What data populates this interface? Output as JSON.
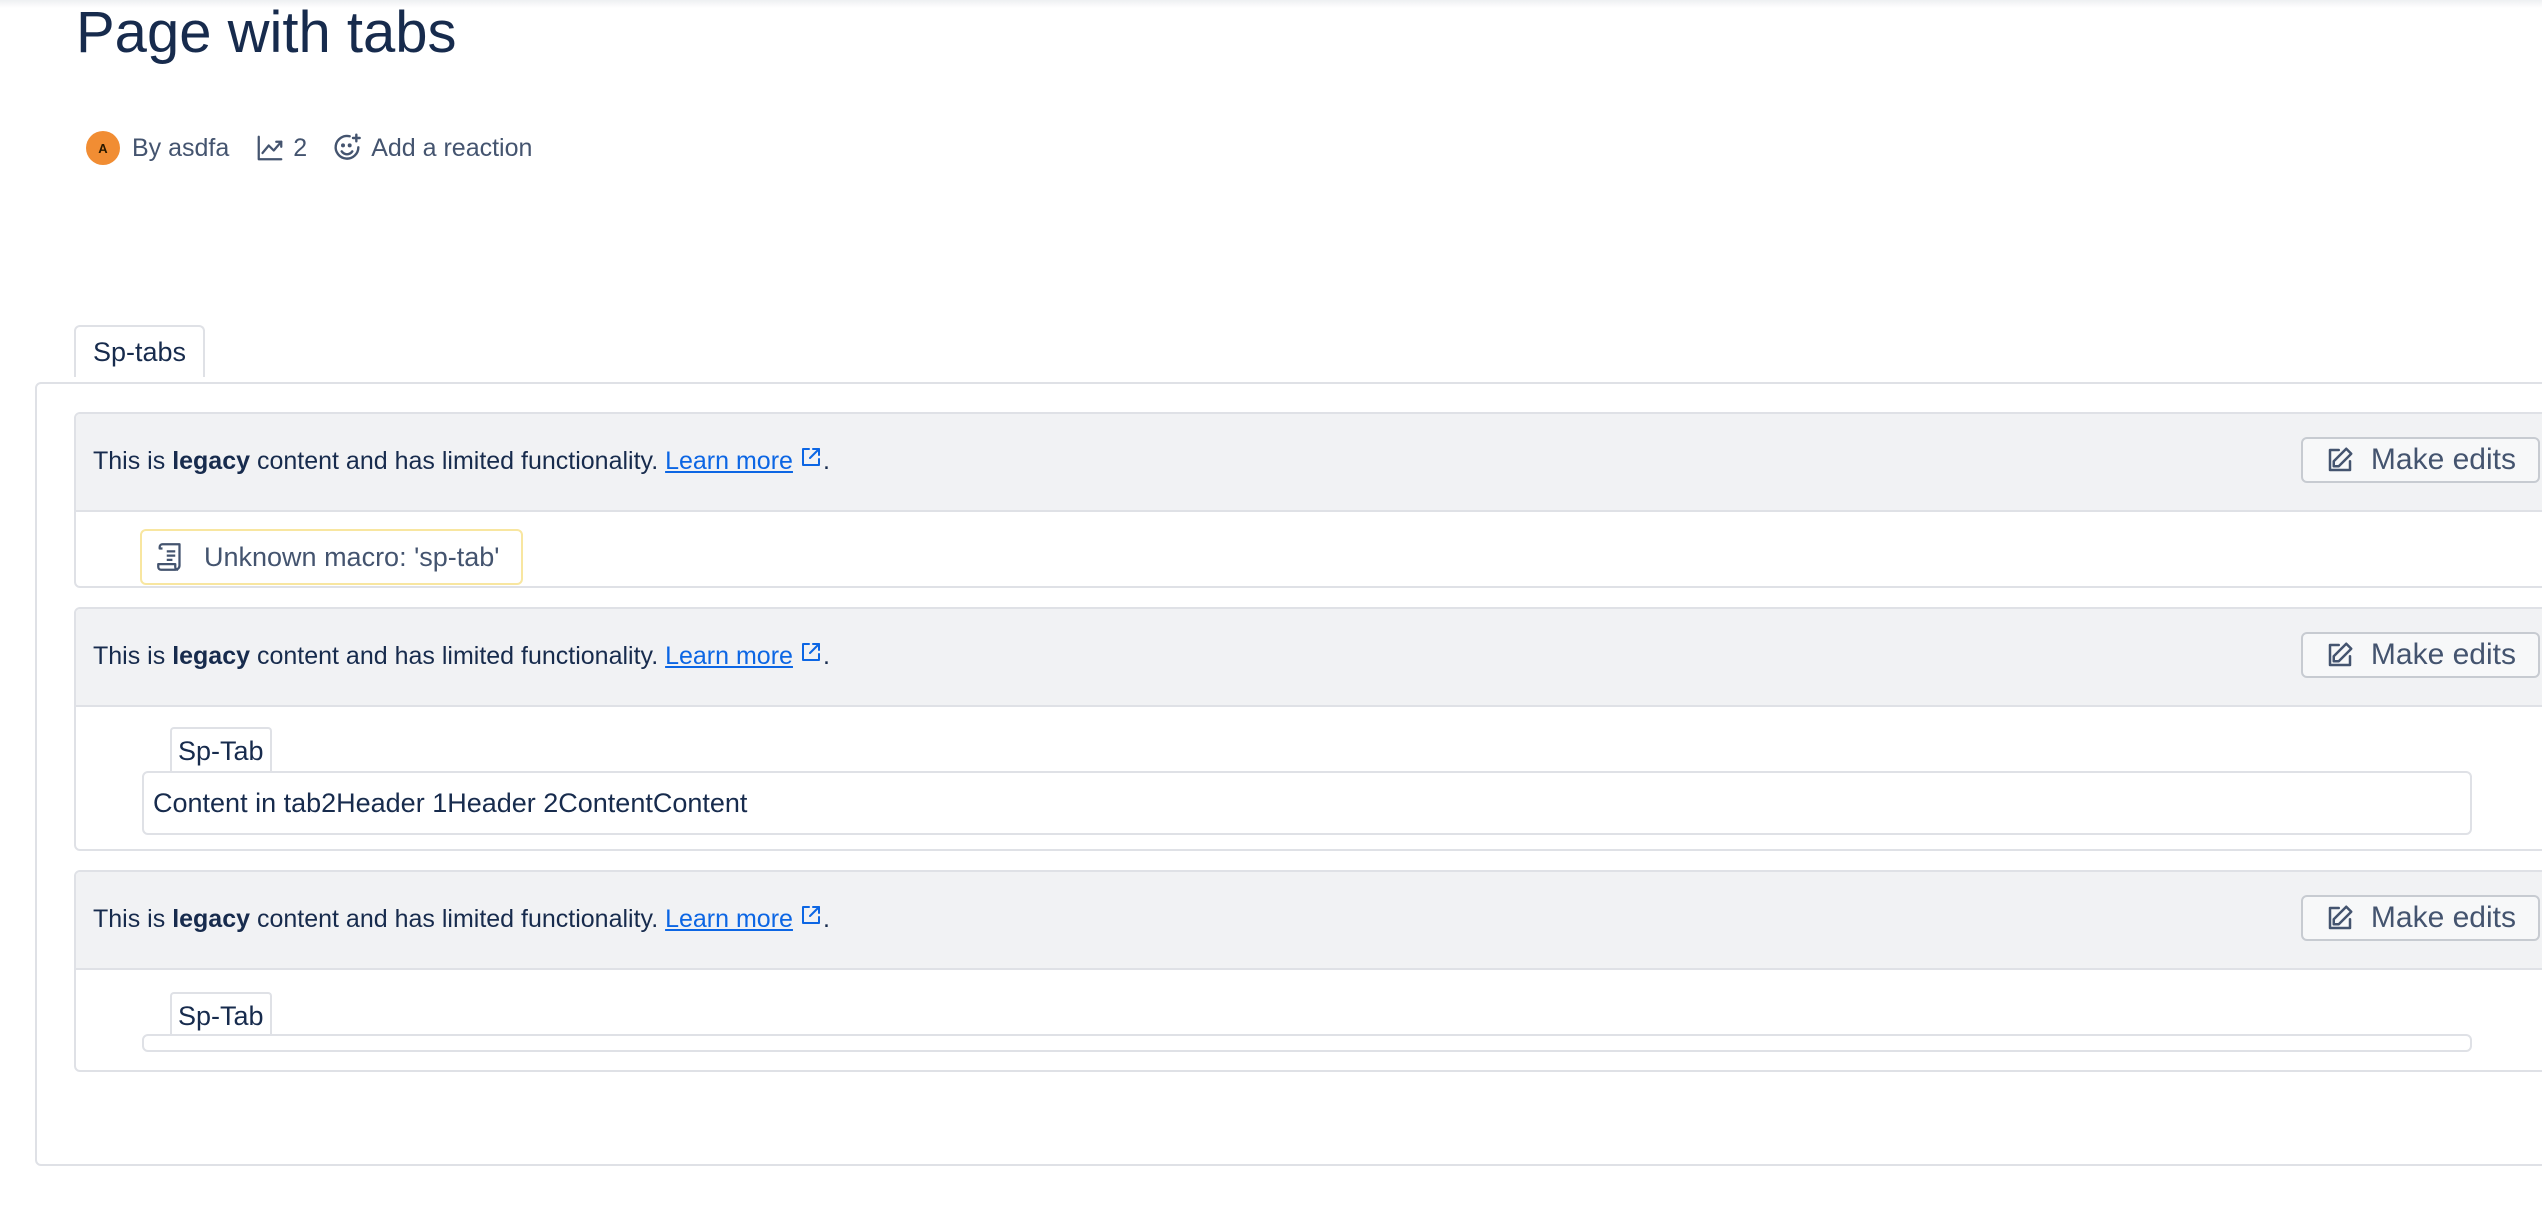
{
  "page": {
    "title": "Page with tabs",
    "byline": {
      "avatar_initial": "A",
      "author": "By asdfa",
      "views": "2",
      "reaction": "Add a reaction"
    }
  },
  "tabs_macro": {
    "label": "Sp-tabs",
    "legacy_notice": {
      "prefix": "This is ",
      "bold": "legacy",
      "suffix": " content and has limited functionality. ",
      "link": "Learn more",
      "end": "."
    },
    "make_edits_label": "Make edits",
    "blocks": [
      {
        "unknown_macro": "Unknown macro: 'sp-tab'"
      },
      {
        "tab_label": "Sp-Tab",
        "tab_content": "Content in tab2Header 1Header 2ContentContent"
      },
      {
        "tab_label": "Sp-Tab",
        "tab_content": ""
      }
    ]
  },
  "colors": {
    "link": "#0c66e4",
    "avatar": "#f18d33",
    "legacy_header_bg": "#f1f2f4",
    "unknown_macro_border": "#f8e6a0"
  },
  "icons": [
    "views-icon",
    "reaction-icon",
    "external-link-icon",
    "edit-icon",
    "scroll-icon"
  ]
}
